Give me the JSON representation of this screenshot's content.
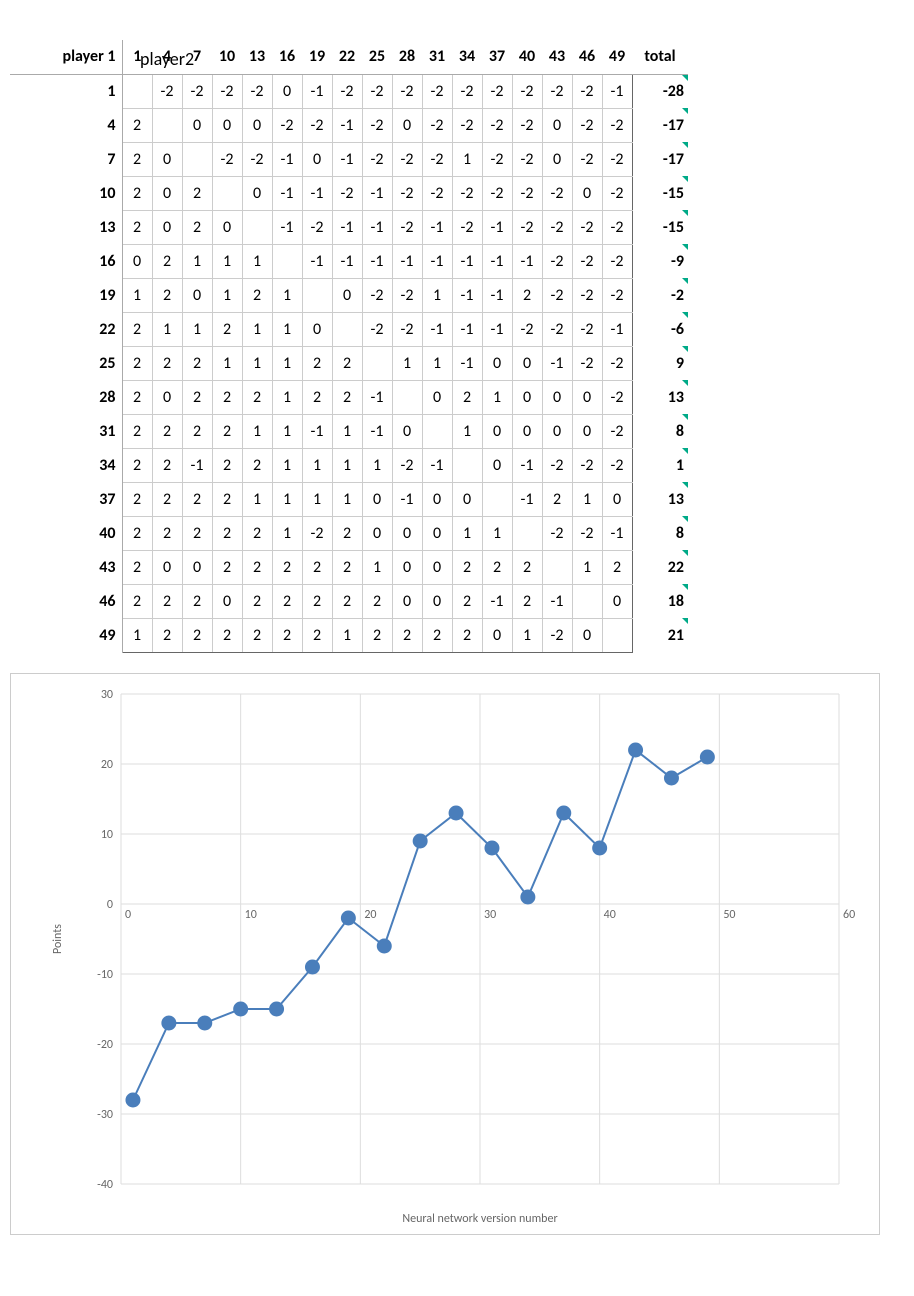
{
  "top_label": "player2",
  "side_label": "player 1",
  "col_headers": [
    "1",
    "4",
    "7",
    "10",
    "13",
    "16",
    "19",
    "22",
    "25",
    "28",
    "31",
    "34",
    "37",
    "40",
    "43",
    "46",
    "49",
    "total"
  ],
  "rows": [
    {
      "label": "1",
      "cells": [
        "",
        "-2",
        "-2",
        "-2",
        "-2",
        "0",
        "-1",
        "-2",
        "-2",
        "-2",
        "-2",
        "-2",
        "-2",
        "-2",
        "-2",
        "-2",
        "-1"
      ],
      "total": "-28"
    },
    {
      "label": "4",
      "cells": [
        "2",
        "",
        "0",
        "0",
        "0",
        "-2",
        "-2",
        "-1",
        "-2",
        "0",
        "-2",
        "-2",
        "-2",
        "-2",
        "0",
        "-2",
        "-2"
      ],
      "total": "-17"
    },
    {
      "label": "7",
      "cells": [
        "2",
        "0",
        "",
        "-2",
        "-2",
        "-1",
        "0",
        "-1",
        "-2",
        "-2",
        "-2",
        "1",
        "-2",
        "-2",
        "0",
        "-2",
        "-2"
      ],
      "total": "-17"
    },
    {
      "label": "10",
      "cells": [
        "2",
        "0",
        "2",
        "",
        "0",
        "-1",
        "-1",
        "-2",
        "-1",
        "-2",
        "-2",
        "-2",
        "-2",
        "-2",
        "-2",
        "0",
        "-2"
      ],
      "total": "-15"
    },
    {
      "label": "13",
      "cells": [
        "2",
        "0",
        "2",
        "0",
        "",
        "-1",
        "-2",
        "-1",
        "-1",
        "-2",
        "-1",
        "-2",
        "-1",
        "-2",
        "-2",
        "-2",
        "-2"
      ],
      "total": "-15"
    },
    {
      "label": "16",
      "cells": [
        "0",
        "2",
        "1",
        "1",
        "1",
        "",
        "-1",
        "-1",
        "-1",
        "-1",
        "-1",
        "-1",
        "-1",
        "-1",
        "-2",
        "-2",
        "-2"
      ],
      "total": "-9"
    },
    {
      "label": "19",
      "cells": [
        "1",
        "2",
        "0",
        "1",
        "2",
        "1",
        "",
        "0",
        "-2",
        "-2",
        "1",
        "-1",
        "-1",
        "2",
        "-2",
        "-2",
        "-2"
      ],
      "total": "-2"
    },
    {
      "label": "22",
      "cells": [
        "2",
        "1",
        "1",
        "2",
        "1",
        "1",
        "0",
        "",
        "-2",
        "-2",
        "-1",
        "-1",
        "-1",
        "-2",
        "-2",
        "-2",
        "-1"
      ],
      "total": "-6"
    },
    {
      "label": "25",
      "cells": [
        "2",
        "2",
        "2",
        "1",
        "1",
        "1",
        "2",
        "2",
        "",
        "1",
        "1",
        "-1",
        "0",
        "0",
        "-1",
        "-2",
        "-2"
      ],
      "total": "9"
    },
    {
      "label": "28",
      "cells": [
        "2",
        "0",
        "2",
        "2",
        "2",
        "1",
        "2",
        "2",
        "-1",
        "",
        "0",
        "2",
        "1",
        "0",
        "0",
        "0",
        "-2"
      ],
      "total": "13"
    },
    {
      "label": "31",
      "cells": [
        "2",
        "2",
        "2",
        "2",
        "1",
        "1",
        "-1",
        "1",
        "-1",
        "0",
        "",
        "1",
        "0",
        "0",
        "0",
        "0",
        "-2"
      ],
      "total": "8"
    },
    {
      "label": "34",
      "cells": [
        "2",
        "2",
        "-1",
        "2",
        "2",
        "1",
        "1",
        "1",
        "1",
        "-2",
        "-1",
        "",
        "0",
        "-1",
        "-2",
        "-2",
        "-2"
      ],
      "total": "1"
    },
    {
      "label": "37",
      "cells": [
        "2",
        "2",
        "2",
        "2",
        "1",
        "1",
        "1",
        "1",
        "0",
        "-1",
        "0",
        "0",
        "",
        "-1",
        "2",
        "1",
        "0"
      ],
      "total": "13"
    },
    {
      "label": "40",
      "cells": [
        "2",
        "2",
        "2",
        "2",
        "2",
        "1",
        "-2",
        "2",
        "0",
        "0",
        "0",
        "1",
        "1",
        "",
        "-2",
        "-2",
        "-1"
      ],
      "total": "8"
    },
    {
      "label": "43",
      "cells": [
        "2",
        "0",
        "0",
        "2",
        "2",
        "2",
        "2",
        "2",
        "1",
        "0",
        "0",
        "2",
        "2",
        "2",
        "",
        "1",
        "2"
      ],
      "total": "22"
    },
    {
      "label": "46",
      "cells": [
        "2",
        "2",
        "2",
        "0",
        "2",
        "2",
        "2",
        "2",
        "2",
        "0",
        "0",
        "2",
        "-1",
        "2",
        "-1",
        "",
        "0"
      ],
      "total": "18"
    },
    {
      "label": "49",
      "cells": [
        "1",
        "2",
        "2",
        "2",
        "2",
        "2",
        "2",
        "1",
        "2",
        "2",
        "2",
        "2",
        "0",
        "1",
        "-2",
        "0",
        ""
      ],
      "total": "21"
    }
  ],
  "chart_data": {
    "type": "line",
    "title": "",
    "xlabel": "Neural network version number",
    "ylabel": "Points",
    "xlim": [
      0,
      60
    ],
    "ylim": [
      -40,
      30
    ],
    "y_ticks": [
      -40,
      -30,
      -20,
      -10,
      0,
      10,
      20,
      30
    ],
    "x_ticks": [
      0,
      10,
      20,
      30,
      40,
      50,
      60
    ],
    "x": [
      1,
      4,
      7,
      10,
      13,
      16,
      19,
      22,
      25,
      28,
      31,
      34,
      37,
      40,
      43,
      46,
      49
    ],
    "values": [
      -28,
      -17,
      -17,
      -15,
      -15,
      -9,
      -2,
      -6,
      9,
      13,
      8,
      1,
      13,
      8,
      22,
      18,
      21
    ]
  }
}
